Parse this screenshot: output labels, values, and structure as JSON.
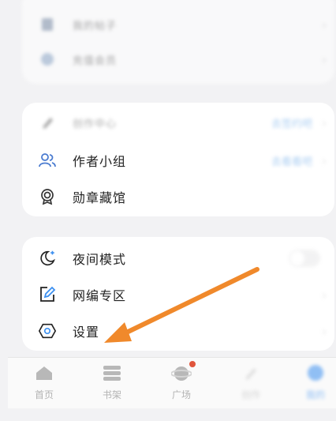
{
  "menu_group_top": {
    "items": [
      {
        "label": "我的帖子"
      },
      {
        "label": "充值会员"
      }
    ]
  },
  "menu_group_mid": {
    "items": [
      {
        "label": "创作中心",
        "value": "去签约吧"
      },
      {
        "label": "作者小组",
        "value": "去看看吧"
      },
      {
        "label": "勋章藏馆"
      }
    ]
  },
  "menu_group_settings": {
    "items": [
      {
        "label": "夜间模式",
        "icon": "moon-icon",
        "toggle_on": false
      },
      {
        "label": "网编专区",
        "icon": "edit-icon"
      },
      {
        "label": "设置",
        "icon": "settings-gear-icon"
      }
    ]
  },
  "tabbar": {
    "tabs": [
      {
        "label": "首页"
      },
      {
        "label": "书架"
      },
      {
        "label": "广场"
      },
      {
        "label": "创作"
      },
      {
        "label": "我的"
      }
    ]
  },
  "colors": {
    "accent": "#3b8ff0",
    "arrow": "#f0892b",
    "badge": "#e0553c"
  }
}
